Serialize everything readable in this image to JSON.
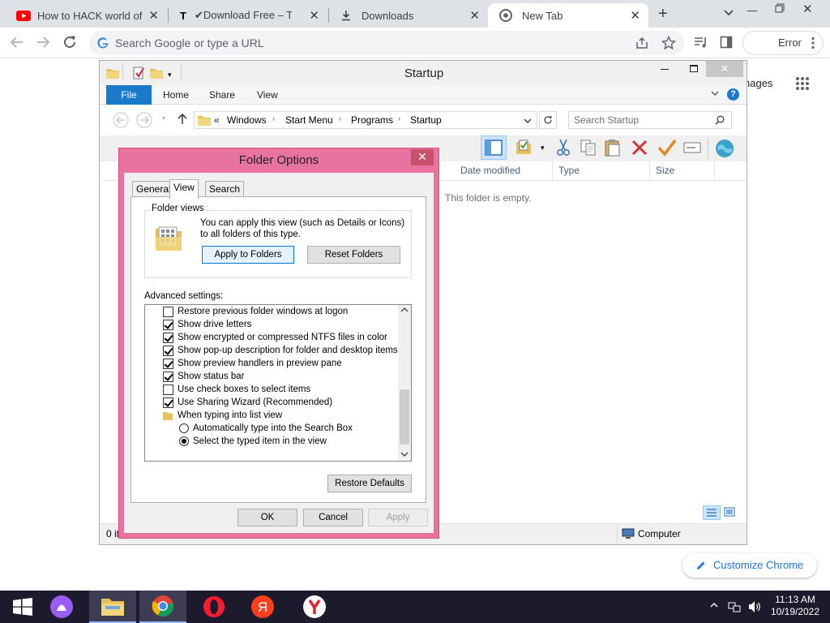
{
  "chrome": {
    "tabs": [
      {
        "title": "How to HACK world of ta",
        "icon": "youtube-icon"
      },
      {
        "title": "✔Download Free – Teleg",
        "icon": "t-icon"
      },
      {
        "title": "Downloads",
        "icon": "download-icon"
      },
      {
        "title": "New Tab",
        "icon": "chrome-icon"
      }
    ],
    "omnibox_placeholder": "Search Google or type a URL",
    "profile_button": "Error",
    "page_partial_text": "nages",
    "customize_chrome": "Customize Chrome"
  },
  "explorer": {
    "title": "Startup",
    "ribbon_tabs": [
      "File",
      "Home",
      "Share",
      "View"
    ],
    "breadcrumb": [
      "Windows",
      "Start Menu",
      "Programs",
      "Startup"
    ],
    "search_placeholder": "Search Startup",
    "columns": [
      "Date modified",
      "Type",
      "Size"
    ],
    "empty_text": "This folder is empty.",
    "status_items": "0 it",
    "status_location": "Computer"
  },
  "dialog": {
    "title": "Folder Options",
    "tabs": [
      "General",
      "View",
      "Search"
    ],
    "folder_views": {
      "legend": "Folder views",
      "description": "You can apply this view (such as Details or Icons) to all folders of this type.",
      "apply_button": "Apply to Folders",
      "reset_button": "Reset Folders"
    },
    "advanced_label": "Advanced settings:",
    "advanced_items": [
      {
        "label": "Restore previous folder windows at logon",
        "kind": "checkbox",
        "checked": false
      },
      {
        "label": "Show drive letters",
        "kind": "checkbox",
        "checked": true
      },
      {
        "label": "Show encrypted or compressed NTFS files in color",
        "kind": "checkbox",
        "checked": true
      },
      {
        "label": "Show pop-up description for folder and desktop items",
        "kind": "checkbox",
        "checked": true
      },
      {
        "label": "Show preview handlers in preview pane",
        "kind": "checkbox",
        "checked": true
      },
      {
        "label": "Show status bar",
        "kind": "checkbox",
        "checked": true
      },
      {
        "label": "Use check boxes to select items",
        "kind": "checkbox",
        "checked": false
      },
      {
        "label": "Use Sharing Wizard (Recommended)",
        "kind": "checkbox",
        "checked": true
      },
      {
        "label": "When typing into list view",
        "kind": "folder",
        "checked": false
      },
      {
        "label": "Automatically type into the Search Box",
        "kind": "radio",
        "checked": false
      },
      {
        "label": "Select the typed item in the view",
        "kind": "radio",
        "checked": true
      }
    ],
    "restore_defaults": "Restore Defaults",
    "ok": "OK",
    "cancel": "Cancel",
    "apply": "Apply"
  },
  "taskbar": {
    "time": "11:13 AM",
    "date": "10/19/2022"
  },
  "colors": {
    "dialog_frame": "#e9739f",
    "file_tab": "#1979ca",
    "taskbar": "#1c1b2e",
    "accent": "#1a73e8"
  }
}
